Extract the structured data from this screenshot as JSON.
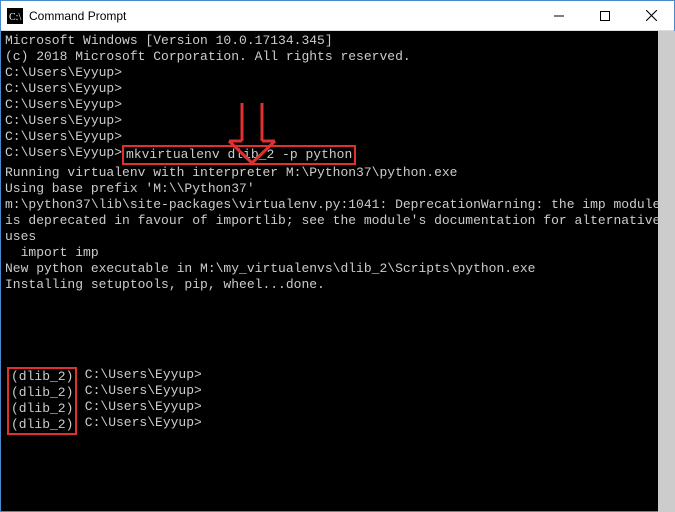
{
  "window": {
    "title": "Command Prompt"
  },
  "terminal": {
    "header1": "Microsoft Windows [Version 10.0.17134.345]",
    "header2": "(c) 2018 Microsoft Corporation. All rights reserved.",
    "blank": "",
    "prompt1": "C:\\Users\\Eyyup>",
    "prompt2": "C:\\Users\\Eyyup>",
    "prompt3": "C:\\Users\\Eyyup>",
    "prompt4": "C:\\Users\\Eyyup>",
    "prompt5": "C:\\Users\\Eyyup>",
    "cmd_prefix": "C:\\Users\\Eyyup>",
    "cmd": "mkvirtualenv dlib_2 -p python",
    "out1": "Running virtualenv with interpreter M:\\Python37\\python.exe",
    "out2": "Using base prefix 'M:\\\\Python37'",
    "out3": "m:\\python37\\lib\\site-packages\\virtualenv.py:1041: DeprecationWarning: the imp module is deprecated in favour of importlib; see the module's documentation for alternative uses",
    "out4": "  import imp",
    "out5": "New python executable in M:\\my_virtualenvs\\dlib_2\\Scripts\\python.exe",
    "out6": "Installing setuptools, pip, wheel...done.",
    "venv1": "(dlib_2)",
    "venv2": "(dlib_2)",
    "venv3": "(dlib_2)",
    "venv4": "(dlib_2)",
    "vprompt1": " C:\\Users\\Eyyup>",
    "vprompt2": " C:\\Users\\Eyyup>",
    "vprompt3": " C:\\Users\\Eyyup>",
    "vprompt4": " C:\\Users\\Eyyup>"
  },
  "annotations": {
    "arrow_color": "#e03030",
    "highlight_box_color": "#e03030"
  }
}
